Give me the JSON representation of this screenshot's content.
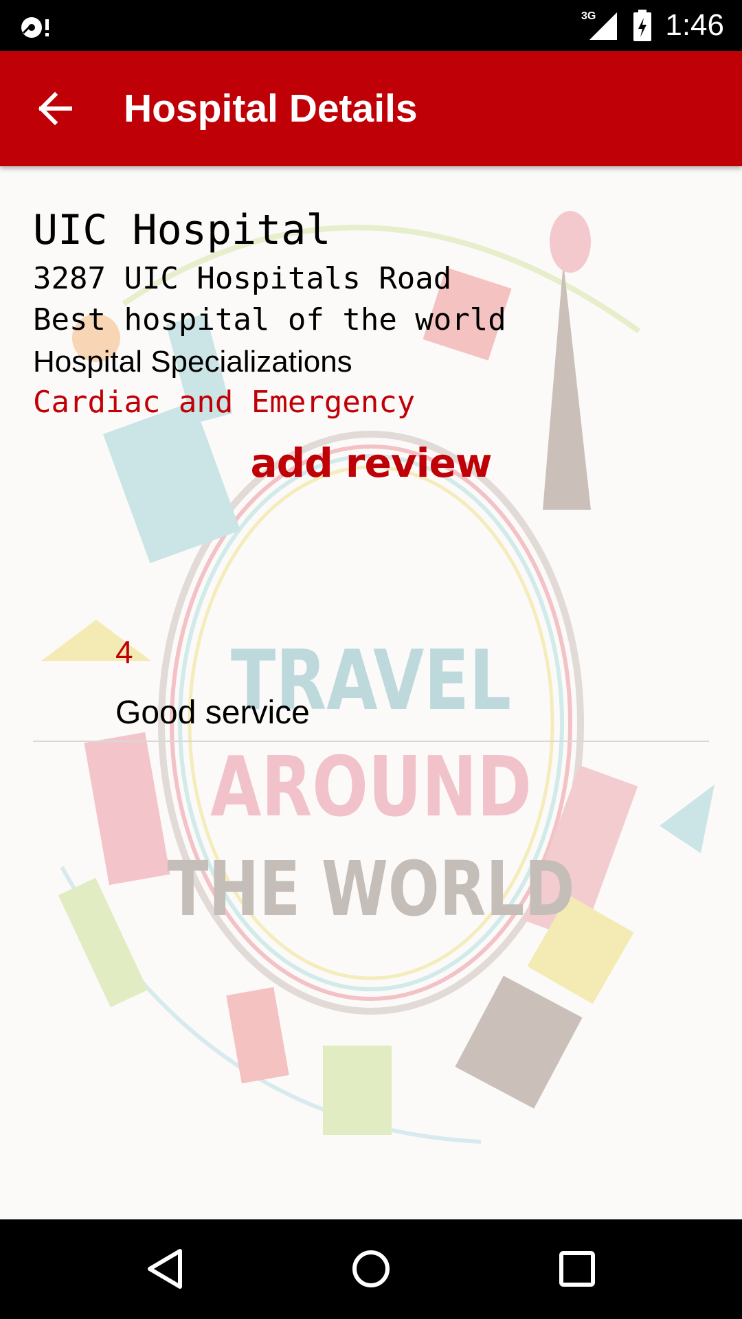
{
  "status_bar": {
    "time": "1:46",
    "network": "3G",
    "icons": [
      "debug-notification-icon",
      "signal-icon",
      "battery-charging-icon"
    ]
  },
  "app_bar": {
    "title": "Hospital Details",
    "back_icon": "arrow-back-icon"
  },
  "hospital": {
    "name": "UIC Hospital",
    "address": "3287 UIC Hospitals Road",
    "description": "Best hospital of the world",
    "specializations_label": "Hospital Specializations",
    "specializations": "Cardiac and Emergency"
  },
  "actions": {
    "add_review_label": "add review"
  },
  "reviews": [
    {
      "rating": "4",
      "comment": "Good service"
    }
  ],
  "background_art": {
    "words": [
      "TRAVEL",
      "AROUND",
      "THE WORLD"
    ]
  },
  "nav_bar": {
    "icons": [
      "back-triangle-icon",
      "home-circle-icon",
      "recents-square-icon"
    ]
  },
  "colors": {
    "accent": "#c00007",
    "status_bar": "#000000",
    "nav_bar": "#000000",
    "text": "#000000"
  }
}
